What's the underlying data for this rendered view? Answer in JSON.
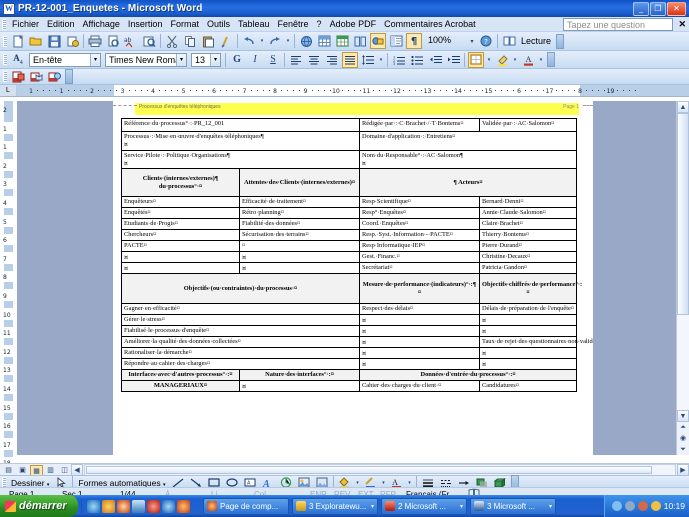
{
  "window": {
    "title": "PR-12-001_Enquetes - Microsoft Word",
    "app_icon": "word-document-icon",
    "minimize": "_",
    "restore": "❐",
    "close": "✕"
  },
  "menubar": {
    "items": [
      "Fichier",
      "Edition",
      "Affichage",
      "Insertion",
      "Format",
      "Outils",
      "Tableau",
      "Fenêtre",
      "?",
      "Adobe PDF",
      "Commentaires Acrobat"
    ],
    "ask_placeholder": "Tapez une question",
    "close_label": "✕"
  },
  "standard_toolbar": {
    "zoom": "100%",
    "reading_label": "Lecture",
    "icons": [
      "new-document-icon",
      "open-folder-icon",
      "save-icon",
      "permission-icon",
      "print-icon",
      "print-preview-icon",
      "spelling-check-icon",
      "research-icon",
      "cut-icon",
      "copy-icon",
      "paste-icon",
      "format-painter-icon",
      "undo-icon",
      "redo-icon",
      "insert-hyperlink-icon",
      "insert-table-icon",
      "insert-excel-sheet-icon",
      "columns-icon",
      "drawing-icon",
      "document-map-icon",
      "show-formatting-marks-icon",
      "help-icon"
    ]
  },
  "formatting_toolbar": {
    "style": "En-tête",
    "font": "Times New Roman",
    "size": "13",
    "bold": "G",
    "italic": "I",
    "underline": "S",
    "icons": [
      "align-left-icon",
      "align-center-icon",
      "align-right-icon",
      "justify-icon",
      "line-spacing-icon",
      "numbered-list-icon",
      "bulleted-list-icon",
      "decrease-indent-icon",
      "increase-indent-icon",
      "borders-icon",
      "highlight-color-icon",
      "font-color-icon"
    ]
  },
  "acrobat_toolbar": {
    "icons": [
      "convert-to-pdf-icon",
      "convert-and-email-pdf-icon",
      "convert-and-review-pdf-icon"
    ]
  },
  "ruler": {
    "h_ticks": [
      "1",
      "1",
      "2",
      "3",
      "4",
      "5",
      "6",
      "7",
      "8",
      "9",
      "10",
      "11",
      "12",
      "13",
      "14",
      "15",
      "6",
      "17",
      "8",
      "19"
    ],
    "v_ticks": [
      "2",
      "1",
      "1",
      "2",
      "3",
      "4",
      "5",
      "6",
      "7",
      "8",
      "9",
      "10",
      "11",
      "12",
      "13",
      "14",
      "15",
      "16",
      "17",
      "18"
    ]
  },
  "document": {
    "header_ghost": "Processus d'enquêtes téléphoniques",
    "header_right_ghost": "Page 1",
    "table": {
      "row_reference": {
        "reference_label": "Référence·du·processus°·:·PR_12_001",
        "written_by": "Rédigée·par·:·C·Brachet·/·T·Bontems¤",
        "validated_by": "Validée·par·:·AC·Salomon¤"
      },
      "row_process": {
        "process": "Processus·:·Mise·en·œuvre·d'enquêtes·téléphoniques¶",
        "process_marker": "¤",
        "domain": "Domaine·d'application·:·Entretiens¤"
      },
      "row_service": {
        "service": "Service·Pilote·:·Politique·Organisations¶",
        "service_marker": "¤",
        "manager": "Nom·du·Responsable°·:·AC·Salomon¶",
        "manager_marker": "¤"
      },
      "clients_headers": {
        "clients": "Clients·(internes/externes)¶ du·processus°·¤",
        "expectations": "Attentes·des·Clients·(internes/externes)¤",
        "actors": "¶ Acteurs¤"
      },
      "clients_rows": [
        {
          "client": "Enquêteurs¤",
          "expectation": "Efficacité·de·traitement¤",
          "role": "Resp·Scientifique¤",
          "person": "Bernard·Denni¤"
        },
        {
          "client": "Enquêtés¤",
          "expectation": "Rétro·planning¤",
          "role": "Resp°·Enquêtes¤",
          "person": "Annie·Claude·Salomon¤"
        },
        {
          "client": "Etudiants·de·Progis¤",
          "expectation": "Fiabilité·des·données¤",
          "role": "Coord.·Enquêtes¤",
          "person": "Claire·Brachet¤"
        },
        {
          "client": "Chercheurs¤",
          "expectation": "Sécurisation·des·terrains¤",
          "role": "Resp.·Syst.·Information·-·PACTE¤",
          "person": "Thierry·Bontems¤"
        },
        {
          "client": "PACTE¤",
          "expectation": "¤",
          "role": "Resp·Informatique·IEP¤",
          "person": "Pierre·Durand¤"
        },
        {
          "client": "¤",
          "expectation": "¤",
          "role": "Gest.·Financ.¤",
          "person": "Christine·Decaux¤"
        },
        {
          "client": "¤",
          "expectation": "¤",
          "role": "Secrétariat¤",
          "person": "Patricia·Gandon¤"
        }
      ],
      "objectives_headers": {
        "objectives": "Objectifs·(ou·contraintes)·du·processus·¤",
        "measure": "Mesure·de·performance·(indicateurs)°·:¶ ¤",
        "targets": "Objectifs·chiffrés·de·performance°·:¤"
      },
      "objectives_rows": [
        {
          "objective": "Gagner·en·efficacité¤",
          "measure": "Respect·des·délais¤",
          "target": "Délais·de·préparation·de·l'enquête¤"
        },
        {
          "objective": "Gérer·le·stress¤",
          "measure": "¤",
          "target": "¤"
        },
        {
          "objective": "Fiabilisé·le·processus·d'enquête¤",
          "measure": "¤",
          "target": "¤"
        },
        {
          "objective": "Améliorer·la·qualité·des·données·collectées¤",
          "measure": "¤",
          "target": "Taux·de·rejet·des·questionnaires·non·valide¤"
        },
        {
          "objective": "Rationaliser·la·démarche¤",
          "measure": "¤",
          "target": "¤"
        },
        {
          "objective": "Répondre·au·cahier·des·charges¤",
          "measure": "¤",
          "target": "¤"
        }
      ],
      "interfaces_headers": {
        "interfaces": "Interfaces·avec·d'autres·processus°·:¤",
        "nature": "Nature·des·interfaces°·:¤",
        "input_data": "Données·d'entrée·du·processus°·:¤"
      },
      "interfaces_rows": [
        {
          "interface": "MANAGERIAUX¤",
          "nature": "¤",
          "input_a": "Cahier·des·charges·du·client·¤",
          "input_b": "Candidatures¤"
        }
      ]
    }
  },
  "drawing_toolbar": {
    "draw_label": "Dessiner",
    "autoshapes_label": "Formes automatiques",
    "icons": [
      "select-objects-icon",
      "line-icon",
      "arrow-icon",
      "rectangle-icon",
      "oval-icon",
      "text-box-icon",
      "wordart-icon",
      "diagram-icon",
      "clip-art-icon",
      "picture-icon",
      "fill-color-icon",
      "line-color-icon",
      "font-color-icon",
      "line-style-icon",
      "dash-style-icon",
      "arrow-style-icon",
      "shadow-style-icon",
      "3d-style-icon"
    ]
  },
  "statusbar": {
    "page": "Page 1",
    "section": "Sec 1",
    "page_count": "1/44",
    "at": "À",
    "line": "Li",
    "col": "Col",
    "rec": "ENR",
    "trk": "REV",
    "ext": "EXT",
    "ovr": "RFP",
    "language": "Français (Fr",
    "spellcheck_icon": "spelling-status-icon"
  },
  "view_buttons": {
    "icons": [
      "normal-view-icon",
      "web-layout-view-icon",
      "print-layout-view-icon",
      "outline-view-icon",
      "reading-view-icon"
    ]
  },
  "taskbar": {
    "start_label": "démarrer",
    "quick_launch": [
      "internet-explorer-icon",
      "media-player-icon",
      "opera-icon",
      "winamp-icon",
      "antivirus-icon",
      "explorer-icon",
      "firefox-icon"
    ],
    "tasks": [
      {
        "icon": "firefox-icon",
        "label": "Page de comp..."
      },
      {
        "icon": "folder-icon",
        "label": "3 Exploratewu..."
      },
      {
        "icon": "acrobat-icon",
        "label": "2 Microsoft ..."
      },
      {
        "icon": "word-icon",
        "label": "3 Microsoft ..."
      }
    ],
    "tray_icons": [
      "volume-icon",
      "network-icon",
      "security-icon",
      "update-icon"
    ],
    "clock": "10:19"
  },
  "colors": {
    "title_blue": "#1457cc",
    "toolbar_blue": "#d7e4f5",
    "highlight_yellow": "#ffff4d",
    "margin_gray": "#9aa8c8",
    "taskbar_blue": "#2063cf",
    "start_green": "#39a32c"
  }
}
